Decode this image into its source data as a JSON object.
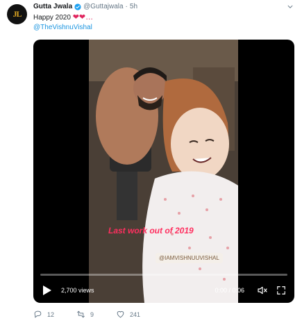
{
  "tweet": {
    "author_name": "Gutta Jwala",
    "handle": "@Guttajwala",
    "separator": "·",
    "time": "5h",
    "text": "Happy 2020",
    "emoji": "❤❤…",
    "mention": "@TheVishnuVishal",
    "avatar_initials": "JL"
  },
  "video": {
    "overlay_caption": "Last work out of 2019",
    "overlay_tag": "@IAMVISHNUUVISHAL",
    "views": "2,700 views",
    "timecode": "0:00 / 0:06",
    "progress": 0
  },
  "actions": {
    "replies": "12",
    "retweets": "9",
    "likes": "241"
  },
  "colors": {
    "link": "#1b95e0",
    "secondary_text": "#657786",
    "heart": "#e0245e",
    "video_caption": "#ff2f5f"
  }
}
